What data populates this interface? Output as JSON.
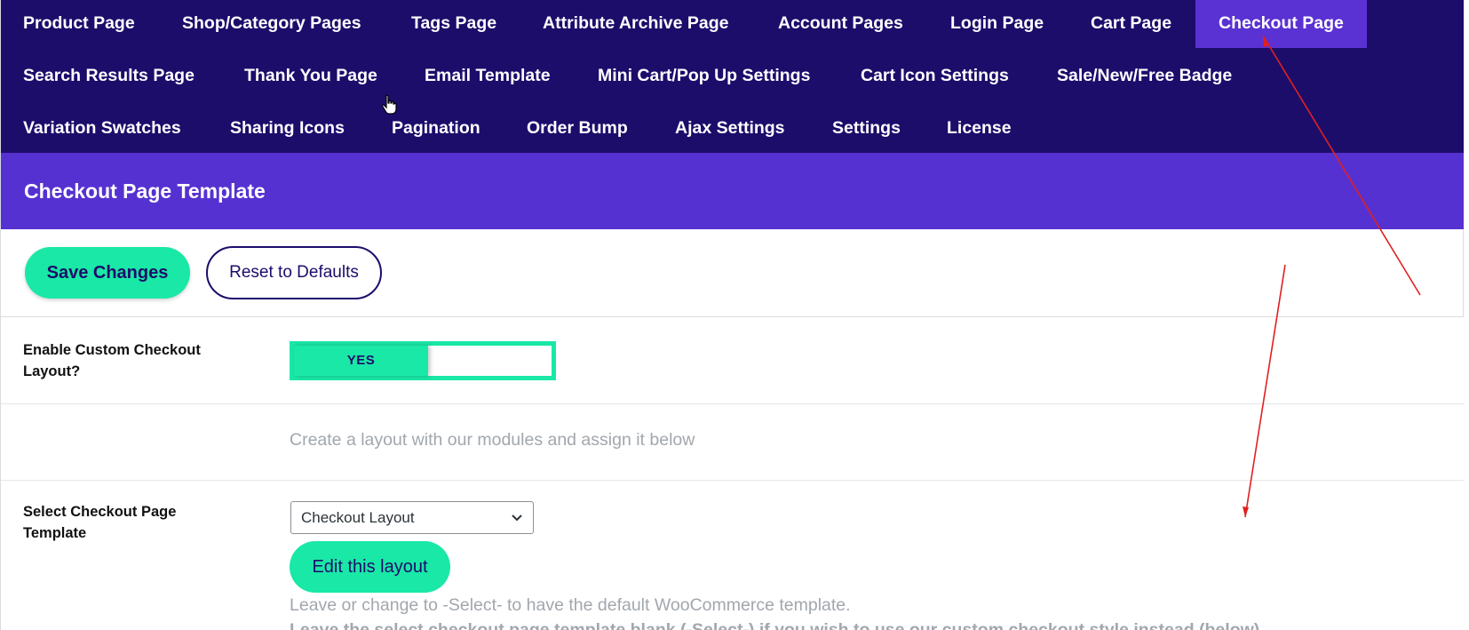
{
  "nav": {
    "row1": [
      "Product Page",
      "Shop/Category Pages",
      "Tags Page",
      "Attribute Archive Page",
      "Account Pages",
      "Login Page",
      "Cart Page",
      "Checkout Page"
    ],
    "row2": [
      "Search Results Page",
      "Thank You Page",
      "Email Template",
      "Mini Cart/Pop Up Settings",
      "Cart Icon Settings",
      "Sale/New/Free Badge"
    ],
    "row3": [
      "Variation Swatches",
      "Sharing Icons",
      "Pagination",
      "Order Bump",
      "Ajax Settings",
      "Settings",
      "License"
    ],
    "active": "Checkout Page"
  },
  "section": {
    "title": "Checkout Page Template"
  },
  "actions": {
    "save_label": "Save Changes",
    "reset_label": "Reset to Defaults"
  },
  "settings": {
    "enable_custom": {
      "label": "Enable Custom Checkout Layout?",
      "toggle_label": "YES"
    },
    "hint": "Create a layout with our modules and assign it below",
    "template": {
      "label": "Select Checkout Page Template",
      "selected": "Checkout Layout",
      "edit_label": "Edit this layout",
      "note": "Leave or change to -Select- to have the default WooCommerce template.",
      "note_bold": "Leave the select checkout page template blank (-Select-) if you wish to use our custom checkout style instead (below)"
    }
  },
  "colors": {
    "nav_bg": "#1c0d6b",
    "header_bg": "#5631d1",
    "accent": "#19e8a6",
    "annotation_arrow": "#e02020"
  }
}
